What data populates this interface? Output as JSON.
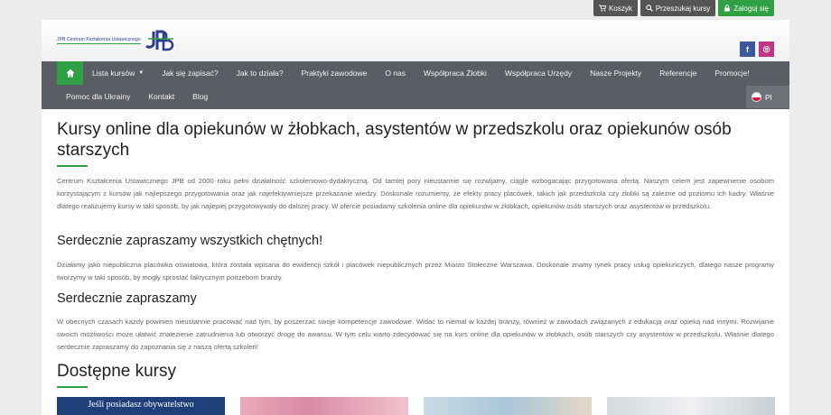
{
  "topbar": {
    "cart": "Koszyk",
    "search": "Przeszukaj kursy",
    "login": "Zaloguj się"
  },
  "logo": {
    "text": "JPB Centrum Kształcenia Ustawicznego",
    "mark": "JPB"
  },
  "social": {
    "facebook": "f",
    "instagram": "◎"
  },
  "nav": {
    "row1": [
      "Lista kursów",
      "Jak się zapisać?",
      "Jak to działa?",
      "Praktyki zawodowe",
      "O nas",
      "Współpraca Żłobki",
      "Współpraca Urzędy",
      "Nasze Projekty",
      "Referencje",
      "Promocje!"
    ],
    "row2": [
      "Pomoc dla Ukrainy",
      "Kontakt",
      "Blog"
    ],
    "language": "Pl"
  },
  "main": {
    "title": "Kursy online dla opiekunów w żłobkach, asystentów w przedszkolu oraz opiekunów osób starszych",
    "intro": "Centrum Kształcenia Ustawicznego JPB od 2000 roku pełni działalność szkoleniowo-dydaktyczną. Od tamtej pory nieustannie się rozwijamy, ciągle wzbogacając przygotowana ofertą. Naszym celem jest zapewnienie osobom korzystającym z kursów jak najlepszego przygotowania oraz jak najefektywniejsze przekazanie wiedzy. Doskonale rozumiemy, że efekty pracy placówek, takich jak przedszkola czy żłobki są zależne od poziomu ich kadry. Właśnie dlatego realizujemy kursy w taki sposób, by jak najlepiej przygotowywały do dalszej pracy. W ofercie posiadamy szkolenia online dla opiekunów w żłobkach, opiekunów osób starszych oraz asystentów w przedszkolu.",
    "h2a": "Serdecznie zapraszamy wszystkich chętnych!",
    "p2": "Działamy jako niepubliczna placówka oświatowa, która została wpisana do ewidencji szkół i placówek niepublicznych przez Miasto Stołeczne Warszawa. Doskonale znamy rynek pracy usług opiekuńczych, dlatego nasze programy tworzymy w taki sposób, by mogły sprostać faktycznym potrzebom branży.",
    "h2b": "Serdecznie zapraszamy",
    "p3": "W obecnych czasach każdy powinien nieustannie pracować nad tym, by poszerzać swoje kompetencje zawodowe. Widać to niemal w każdej branży, również w zawodach związanych z edukacją oraz opieką nad innymi. Rozwijanie swoich możliwości może ułatwić znalezienie zatrudnienia lub otworzyć drogę do awansu. W tym celu warto zdecydować się na kurs online dla opiekunów w żłobkach, osób starszych czy asystentów w przedszkolu. Właśnie dlatego serdecznie zapraszamy do zapoznania się z naszą ofertą szkoleń!",
    "courses_heading": "Dostępne kursy",
    "card1_text": "Jeśli posiadasz obywatelstwo"
  },
  "colors": {
    "accent": "#2fa043",
    "nav_bg": "#5a5d63",
    "facebook": "#3b5998",
    "instagram": "#c13584"
  }
}
